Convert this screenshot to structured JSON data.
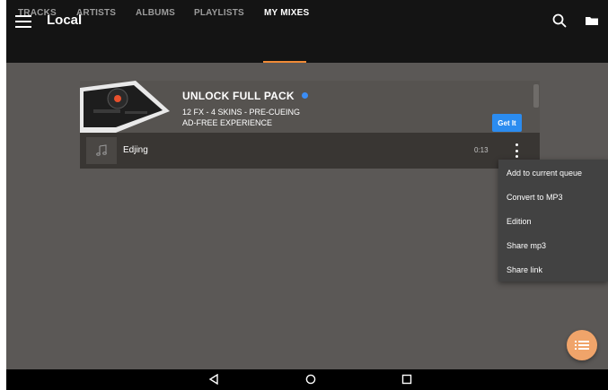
{
  "app": {
    "title": "Local"
  },
  "header": {
    "icons": [
      "menu-icon",
      "search-icon",
      "folder-icon"
    ]
  },
  "tabs": [
    {
      "label": "TRACKS",
      "active": false
    },
    {
      "label": "ARTISTS",
      "active": false
    },
    {
      "label": "ALBUMS",
      "active": false
    },
    {
      "label": "PLAYLISTS",
      "active": false
    },
    {
      "label": "MY MIXES",
      "active": true
    }
  ],
  "promo": {
    "title": "UNLOCK FULL PACK",
    "line1": "12 FX - 4 SKINS - PRE-CUEING",
    "line2": "AD-FREE EXPERIENCE",
    "button": "Get It"
  },
  "track": {
    "name": "Edjing",
    "duration": "0:13",
    "icon": "music-note-icon"
  },
  "context_menu": {
    "items": [
      "Add to current queue",
      "Convert to MP3",
      "Edition",
      "Share mp3",
      "Share link"
    ]
  },
  "fab": {
    "icon": "list-icon"
  },
  "navigation": {
    "buttons": [
      "back-icon",
      "home-icon",
      "recents-icon"
    ]
  },
  "colors": {
    "accent": "#f08a36",
    "fab": "#f0a46a",
    "button": "#2b8cf0",
    "background": "#5b5856",
    "appbar": "#141414"
  }
}
